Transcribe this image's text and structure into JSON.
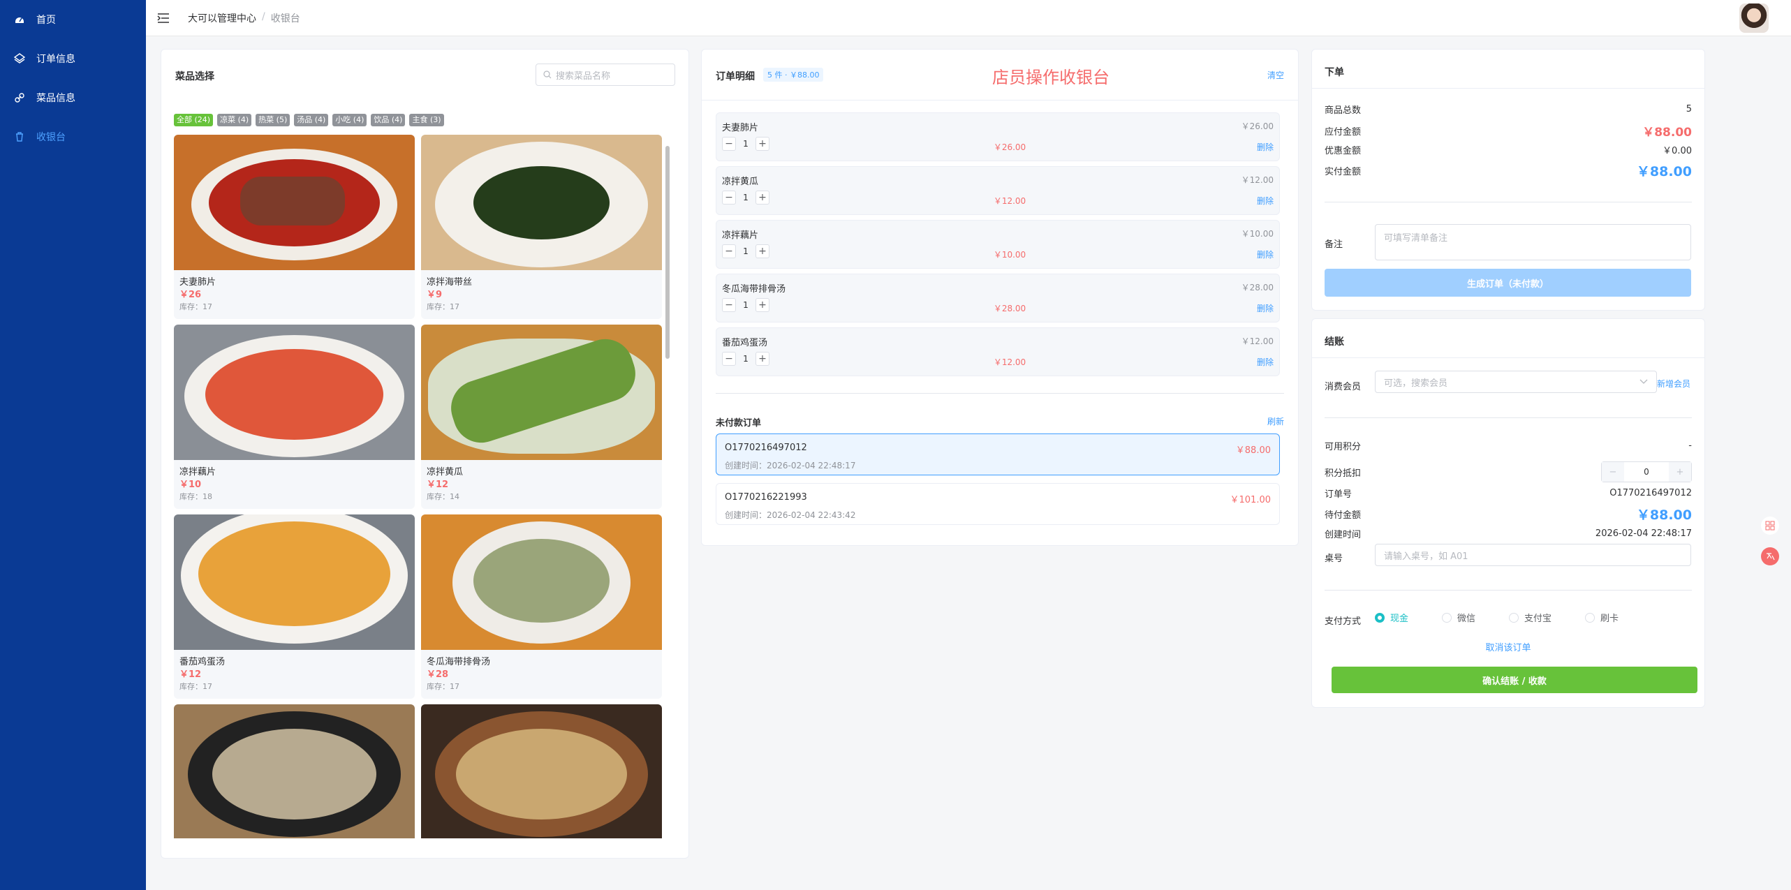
{
  "sidebar": {
    "items": [
      {
        "label": "首页"
      },
      {
        "label": "订单信息"
      },
      {
        "label": "菜品信息"
      },
      {
        "label": "收银台"
      }
    ]
  },
  "header": {
    "breadcrumb_home": "大可以管理中心",
    "breadcrumb_sep": "/",
    "breadcrumb_current": "收银台"
  },
  "dishes_panel": {
    "title": "菜品选择",
    "search_placeholder": "搜索菜品名称",
    "tags": [
      "全部 (24)",
      "凉菜 (4)",
      "热菜 (5)",
      "汤品 (4)",
      "小吃 (4)",
      "饮品 (4)",
      "主食 (3)"
    ],
    "dishes": [
      {
        "name": "夫妻肺片",
        "price": "￥26",
        "stock": "库存：17"
      },
      {
        "name": "凉拌海带丝",
        "price": "￥9",
        "stock": "库存：17"
      },
      {
        "name": "凉拌藕片",
        "price": "￥10",
        "stock": "库存：18"
      },
      {
        "name": "凉拌黄瓜",
        "price": "￥12",
        "stock": "库存：14"
      },
      {
        "name": "番茄鸡蛋汤",
        "price": "￥12",
        "stock": "库存：17"
      },
      {
        "name": "冬瓜海带排骨汤",
        "price": "￥28",
        "stock": "库存：17"
      },
      {
        "name": "",
        "price": "",
        "stock": ""
      },
      {
        "name": "",
        "price": "",
        "stock": ""
      }
    ]
  },
  "order_panel": {
    "title": "订单明细",
    "badge": "5 件 · ￥88.00",
    "headline": "店员操作收银台",
    "clear": "清空",
    "items": [
      {
        "name": "夫妻肺片",
        "unit": "￥26.00",
        "qty": "1",
        "subtotal": "￥26.00",
        "del": "删除"
      },
      {
        "name": "凉拌黄瓜",
        "unit": "￥12.00",
        "qty": "1",
        "subtotal": "￥12.00",
        "del": "删除"
      },
      {
        "name": "凉拌藕片",
        "unit": "￥10.00",
        "qty": "1",
        "subtotal": "￥10.00",
        "del": "删除"
      },
      {
        "name": "冬瓜海带排骨汤",
        "unit": "￥28.00",
        "qty": "1",
        "subtotal": "￥28.00",
        "del": "删除"
      },
      {
        "name": "番茄鸡蛋汤",
        "unit": "￥12.00",
        "qty": "1",
        "subtotal": "￥12.00",
        "del": "删除"
      }
    ],
    "unpaid_title": "未付款订单",
    "refresh": "刷新",
    "unpaid": [
      {
        "no": "O1770216497012",
        "time": "创建时间：2026-02-04 22:48:17",
        "amount": "￥88.00"
      },
      {
        "no": "O1770216221993",
        "time": "创建时间：2026-02-04 22:43:42",
        "amount": "￥101.00"
      }
    ]
  },
  "place_order": {
    "title": "下单",
    "total_count_label": "商品总数",
    "total_count": "5",
    "payable_label": "应付金额",
    "payable": "￥88.00",
    "discount_label": "优惠金额",
    "discount": "￥0.00",
    "actual_label": "实付金额",
    "actual": "￥88.00",
    "remark_label": "备注",
    "remark_placeholder": "可填写清单备注",
    "submit": "生成订单（未付款）"
  },
  "checkout": {
    "title": "结账",
    "member_label": "消费会员",
    "member_placeholder": "可选，搜索会员",
    "new_member": "新增会员",
    "points_label": "可用积分",
    "points": "-",
    "deduct_label": "积分抵扣",
    "deduct": "0",
    "order_no_label": "订单号",
    "order_no": "O1770216497012",
    "due_label": "待付金额",
    "due": "￥88.00",
    "time_label": "创建时间",
    "time": "2026-02-04 22:48:17",
    "table_label": "桌号",
    "table_placeholder": "请输入桌号，如 A01",
    "pay_label": "支付方式",
    "pay_methods": [
      "现金",
      "微信",
      "支付宝",
      "刷卡"
    ],
    "cancel": "取消该订单",
    "confirm": "确认结账 / 收款"
  },
  "colors": {
    "sidebar": "#0a3a94",
    "accent": "#409eff",
    "danger": "#f56c6c",
    "success": "#67c23a"
  }
}
